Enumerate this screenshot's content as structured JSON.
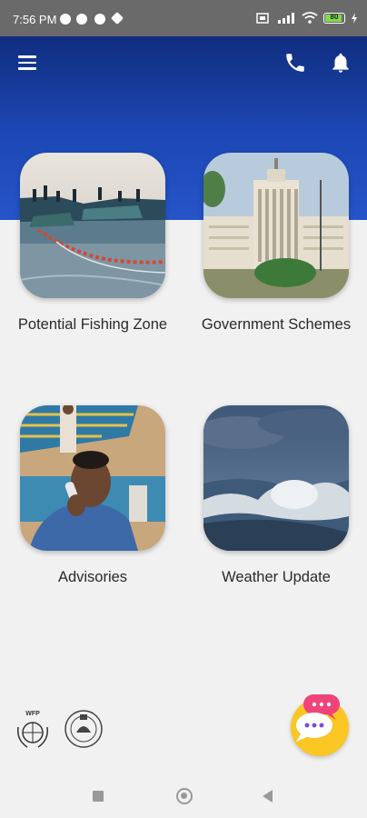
{
  "status_bar": {
    "time": "7:56 PM",
    "battery_level": "80"
  },
  "header": {
    "menu_icon": "hamburger-menu-icon",
    "call_icon": "phone-icon",
    "notification_icon": "bell-icon"
  },
  "tiles": [
    {
      "label": "Potential Fishing Zone",
      "image": "fishing-boats-nets-photo"
    },
    {
      "label": "Government Schemes",
      "image": "government-building-photo"
    },
    {
      "label": "Advisories",
      "image": "fisherman-on-phone-photo"
    },
    {
      "label": "Weather Update",
      "image": "stormy-sea-waves-photo"
    }
  ],
  "footer": {
    "logo_left_text": "WFP",
    "logo_left_name": "wfp-logo",
    "logo_right_name": "odisha-govt-emblem"
  },
  "chat": {
    "icon": "chat-bubbles-icon"
  },
  "colors": {
    "header_dark": "#102e7f",
    "header_light": "#2655c8",
    "background": "#f1f1f1",
    "chat_fab": "#f9c623",
    "chat_pink": "#f0437a",
    "chat_purple": "#7a50d8"
  }
}
